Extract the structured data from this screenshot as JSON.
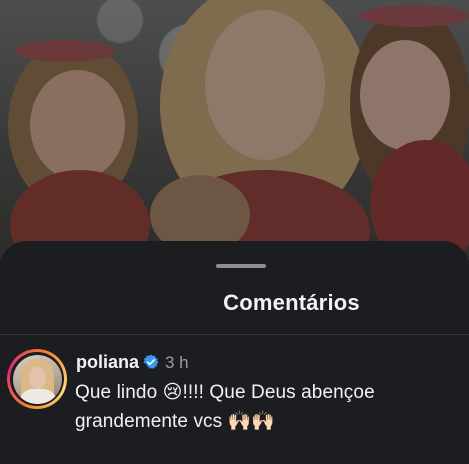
{
  "sheet": {
    "title": "Comentários"
  },
  "comment": {
    "username": "poliana",
    "verified": true,
    "timestamp": "3 h",
    "text_line1": "Que lindo 😢!!!! Que Deus abençoe",
    "text_line2": "grandemente  vcs 🙌🏻🙌🏻"
  },
  "icons": {
    "verified": "verified-badge-icon",
    "grabber": "sheet-grabber"
  },
  "colors": {
    "sheet_background": "#1c1d21",
    "text_primary": "#f2f2f2",
    "text_secondary": "#9a9ba0",
    "verified_blue": "#3897f0"
  }
}
